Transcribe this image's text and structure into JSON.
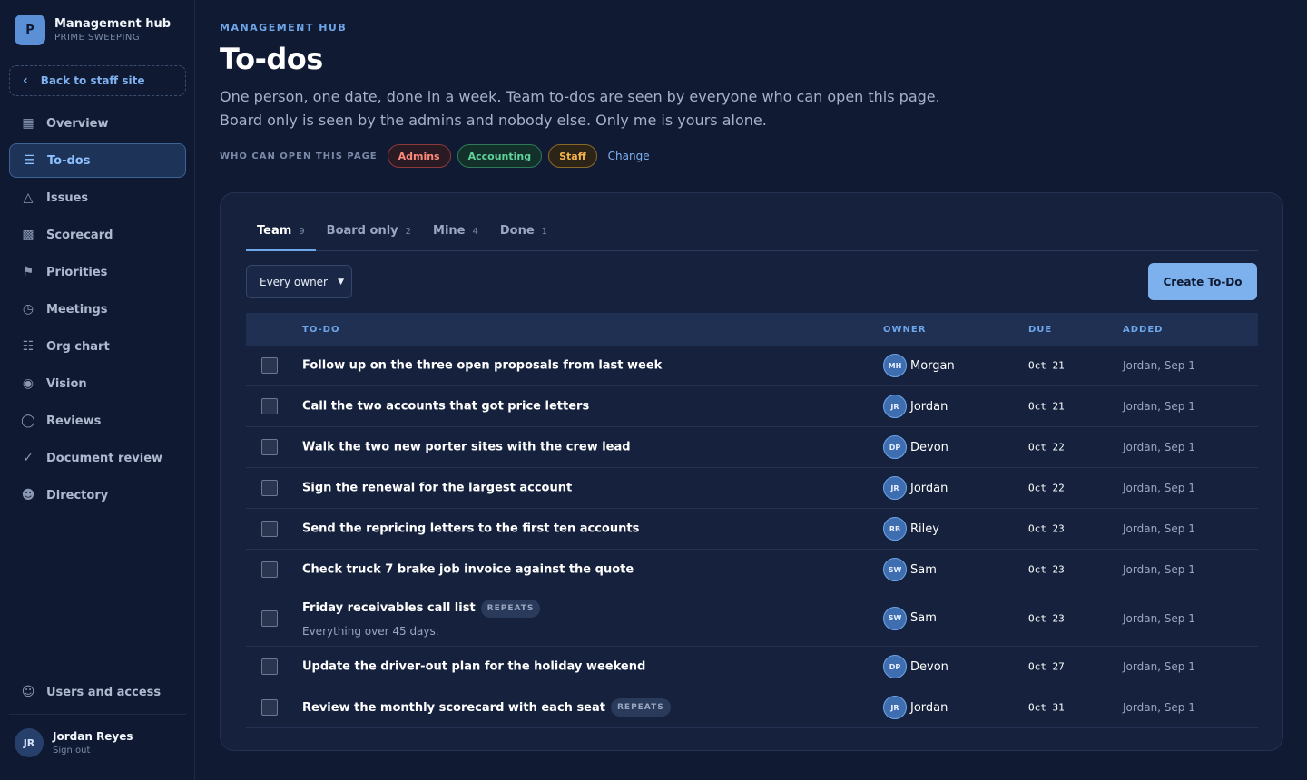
{
  "brand": {
    "logo_letter": "P",
    "title": "Management hub",
    "subtitle": "PRIME SWEEPING"
  },
  "sidebar": {
    "back_label": "Back to staff site",
    "items": [
      {
        "label": "Overview",
        "icon": "grid-icon"
      },
      {
        "label": "To-dos",
        "icon": "list-icon",
        "active": true
      },
      {
        "label": "Issues",
        "icon": "warning-icon"
      },
      {
        "label": "Scorecard",
        "icon": "bar-chart-icon"
      },
      {
        "label": "Priorities",
        "icon": "flag-icon"
      },
      {
        "label": "Meetings",
        "icon": "clock-icon"
      },
      {
        "label": "Org chart",
        "icon": "org-chart-icon"
      },
      {
        "label": "Vision",
        "icon": "eye-icon"
      },
      {
        "label": "Reviews",
        "icon": "chat-icon"
      },
      {
        "label": "Document review",
        "icon": "check-circle-icon"
      },
      {
        "label": "Directory",
        "icon": "people-icon"
      }
    ],
    "users_access_label": "Users and access",
    "user": {
      "initials": "JR",
      "name": "Jordan Reyes",
      "signout": "Sign out"
    }
  },
  "header": {
    "eyebrow": "MANAGEMENT HUB",
    "title": "To-dos",
    "description_line1": "One person, one date, done in a week. Team to-dos are seen by everyone who can open this page.",
    "description_line2": "Board only is seen by the admins and nobody else. Only me is yours alone."
  },
  "access": {
    "label": "WHO CAN OPEN THIS PAGE",
    "groups": [
      "Admins",
      "Accounting",
      "Staff"
    ],
    "change_label": "Change"
  },
  "tabs": [
    {
      "label": "Team",
      "count": "9",
      "active": true
    },
    {
      "label": "Board only",
      "count": "2"
    },
    {
      "label": "Mine",
      "count": "4"
    },
    {
      "label": "Done",
      "count": "1"
    }
  ],
  "filter": {
    "selected": "Every owner"
  },
  "create_button": "Create To-Do",
  "table": {
    "headers": {
      "todo": "TO-DO",
      "owner": "OWNER",
      "due": "DUE",
      "added": "ADDED"
    },
    "repeats_label": "REPEATS",
    "rows": [
      {
        "title": "Follow up on the three open proposals from last week",
        "owner_initials": "MH",
        "owner": "Morgan",
        "due": "Oct 21",
        "added": "Jordan, Sep 1"
      },
      {
        "title": "Call the two accounts that got price letters",
        "owner_initials": "JR",
        "owner": "Jordan",
        "due": "Oct 21",
        "added": "Jordan, Sep 1"
      },
      {
        "title": "Walk the two new porter sites with the crew lead",
        "owner_initials": "DP",
        "owner": "Devon",
        "due": "Oct 22",
        "added": "Jordan, Sep 1"
      },
      {
        "title": "Sign the renewal for the largest account",
        "owner_initials": "JR",
        "owner": "Jordan",
        "due": "Oct 22",
        "added": "Jordan, Sep 1"
      },
      {
        "title": "Send the repricing letters to the first ten accounts",
        "owner_initials": "RB",
        "owner": "Riley",
        "due": "Oct 23",
        "added": "Jordan, Sep 1"
      },
      {
        "title": "Check truck 7 brake job invoice against the quote",
        "owner_initials": "SW",
        "owner": "Sam",
        "due": "Oct 23",
        "added": "Jordan, Sep 1"
      },
      {
        "title": "Friday receivables call list",
        "repeats": true,
        "note": "Everything over 45 days.",
        "owner_initials": "SW",
        "owner": "Sam",
        "due": "Oct 23",
        "added": "Jordan, Sep 1"
      },
      {
        "title": "Update the driver-out plan for the holiday weekend",
        "owner_initials": "DP",
        "owner": "Devon",
        "due": "Oct 27",
        "added": "Jordan, Sep 1"
      },
      {
        "title": "Review the monthly scorecard with each seat",
        "repeats": true,
        "owner_initials": "JR",
        "owner": "Jordan",
        "due": "Oct 31",
        "added": "Jordan, Sep 1"
      }
    ]
  },
  "colors": {
    "accent": "#7db1ee",
    "background": "#101a33",
    "admins": "#ff8a7a",
    "accounting": "#5fd39a",
    "staff": "#f3b34e"
  }
}
